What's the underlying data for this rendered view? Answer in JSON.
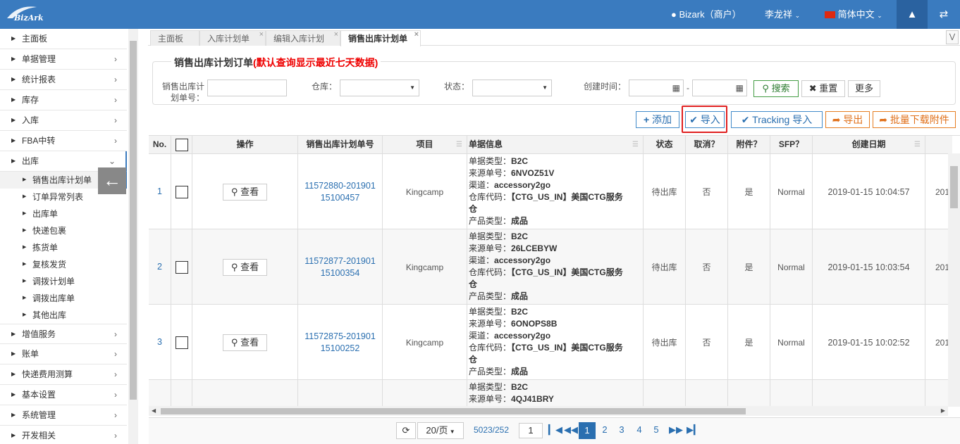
{
  "app": {
    "logo_text": "BizArk"
  },
  "topbar": {
    "account": "Bizark（商户）",
    "user": "李龙祥",
    "language": "简体中文"
  },
  "sidebar": {
    "items": [
      {
        "label": "主面板"
      },
      {
        "label": "单据管理"
      },
      {
        "label": "统计报表"
      },
      {
        "label": "库存"
      },
      {
        "label": "入库"
      },
      {
        "label": "FBA中转"
      },
      {
        "label": "出库"
      }
    ],
    "subitems": [
      {
        "label": "销售出库计划单"
      },
      {
        "label": "订单异常列表"
      },
      {
        "label": "出库单"
      },
      {
        "label": "快递包裹"
      },
      {
        "label": "拣货单"
      },
      {
        "label": "复核发货"
      },
      {
        "label": "调拨计划单"
      },
      {
        "label": "调拨出库单"
      },
      {
        "label": "其他出库"
      }
    ],
    "items_after": [
      {
        "label": "增值服务"
      },
      {
        "label": "账单"
      },
      {
        "label": "快递费用测算"
      },
      {
        "label": "基本设置"
      },
      {
        "label": "系统管理"
      },
      {
        "label": "开发相关"
      }
    ]
  },
  "tabs": [
    {
      "label": "主面板"
    },
    {
      "label": "入库计划单"
    },
    {
      "label": "编辑入库计划"
    },
    {
      "label": "销售出库计划单"
    }
  ],
  "search": {
    "title": "销售出库计划订单",
    "title_note": "(默认查询显示最近七天数据)",
    "order_no_label_1": "销售出库计",
    "order_no_label_2": "划单号：",
    "warehouse_label": "仓库：",
    "status_label": "状态：",
    "created_label": "创建时间：",
    "date_sep": "-",
    "search_btn": "搜索",
    "reset_btn": "重置",
    "more_btn": "更多"
  },
  "actions": {
    "add": "添加",
    "import": "导入",
    "tracking_import": "Tracking 导入",
    "export": "导出",
    "batch_download": "批量下载附件"
  },
  "grid": {
    "headers": [
      "No.",
      "",
      "操作",
      "销售出库计划单号",
      "项目",
      "单据信息",
      "状态",
      "取消？",
      "附件？",
      "SFP？",
      "创建日期"
    ],
    "view_label": "查看",
    "info_labels": {
      "type": "单据类型：",
      "source": "来源单号：",
      "channel": "渠道：",
      "warehouse": "仓库代码：",
      "product": "产品类型："
    },
    "rows": [
      {
        "no": "1",
        "order_a": "11572880-201901",
        "order_b": "15100457",
        "project": "Kingcamp",
        "type": "B2C",
        "source": "6NVOZ51V",
        "channel": "accessory2go",
        "wh1": "【CTG_US_IN】美国CTG服务",
        "wh2": "仓",
        "product": "成品",
        "status": "待出库",
        "cancel": "否",
        "attach": "是",
        "sfp": "Normal",
        "created": "2019-01-15 10:04:57",
        "extra": "201"
      },
      {
        "no": "2",
        "order_a": "11572877-201901",
        "order_b": "15100354",
        "project": "Kingcamp",
        "type": "B2C",
        "source": "26LCEBYW",
        "channel": "accessory2go",
        "wh1": "【CTG_US_IN】美国CTG服务",
        "wh2": "仓",
        "product": "成品",
        "status": "待出库",
        "cancel": "否",
        "attach": "是",
        "sfp": "Normal",
        "created": "2019-01-15 10:03:54",
        "extra": "201"
      },
      {
        "no": "3",
        "order_a": "11572875-201901",
        "order_b": "15100252",
        "project": "Kingcamp",
        "type": "B2C",
        "source": "6ONOPS8B",
        "channel": "accessory2go",
        "wh1": "【CTG_US_IN】美国CTG服务",
        "wh2": "仓",
        "product": "成品",
        "status": "待出库",
        "cancel": "否",
        "attach": "是",
        "sfp": "Normal",
        "created": "2019-01-15 10:02:52",
        "extra": "201"
      },
      {
        "type": "B2C",
        "source": "4QJ41BRY"
      }
    ]
  },
  "pager": {
    "page_size": "20/页",
    "total": "5023/252",
    "goto_value": "1",
    "pages": [
      "1",
      "2",
      "3",
      "4",
      "5"
    ]
  }
}
